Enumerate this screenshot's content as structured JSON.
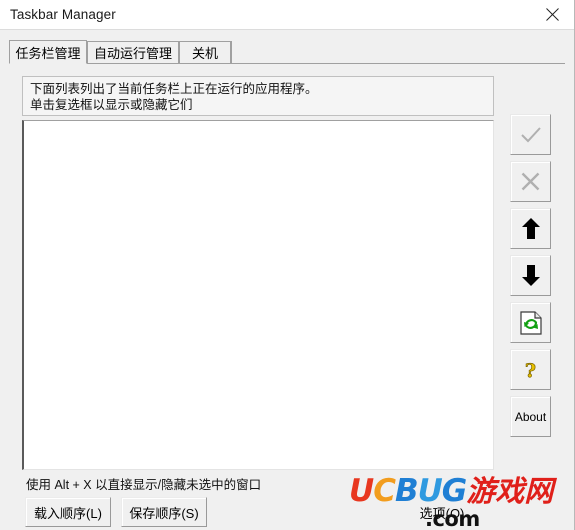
{
  "window": {
    "title": "Taskbar Manager",
    "close_icon": "close-icon"
  },
  "tabs": [
    {
      "label": "任务栏管理",
      "selected": true
    },
    {
      "label": "自动运行管理",
      "selected": false
    },
    {
      "label": "关机",
      "selected": false
    }
  ],
  "description": {
    "line1": "下面列表列出了当前任务栏上正在运行的应用程序。",
    "line2": "单击复选框以显示或隐藏它们"
  },
  "list": {
    "items": []
  },
  "side_buttons": [
    {
      "name": "check-button",
      "icon": "check-icon",
      "label": "",
      "disabled": true
    },
    {
      "name": "cancel-button",
      "icon": "cross-icon",
      "label": "",
      "disabled": true
    },
    {
      "name": "move-up-button",
      "icon": "arrow-up-icon",
      "label": "",
      "disabled": false
    },
    {
      "name": "move-down-button",
      "icon": "arrow-down-icon",
      "label": "",
      "disabled": false
    },
    {
      "name": "refresh-button",
      "icon": "refresh-page-icon",
      "label": "",
      "disabled": false
    },
    {
      "name": "help-button",
      "icon": "question-mark-icon",
      "label": "",
      "disabled": false
    },
    {
      "name": "about-button",
      "icon": "",
      "label": "About",
      "disabled": false
    }
  ],
  "footer": {
    "hint": "使用 Alt + X 以直接显示/隐藏未选中的窗口",
    "load_order_label": "载入顺序(L)",
    "save_order_label": "保存顺序(S)",
    "options_label": "选项(O)"
  },
  "watermark": {
    "u": "U",
    "c": "C",
    "b": "B",
    "u2": "U",
    "g": "G",
    "cn": "游戏网",
    "com": ".com"
  },
  "colors": {
    "window_bg": "#f0f0f0",
    "titlebar_bg": "#ffffff",
    "list_bg": "#ffffff",
    "border": "#a0a0a0",
    "disabled_text": "#a9a9a9",
    "watermark_red": "#e8371f",
    "watermark_orange": "#f29d1e",
    "watermark_blue": "#1f7fd4",
    "watermark_cn_red": "#e0201a"
  }
}
